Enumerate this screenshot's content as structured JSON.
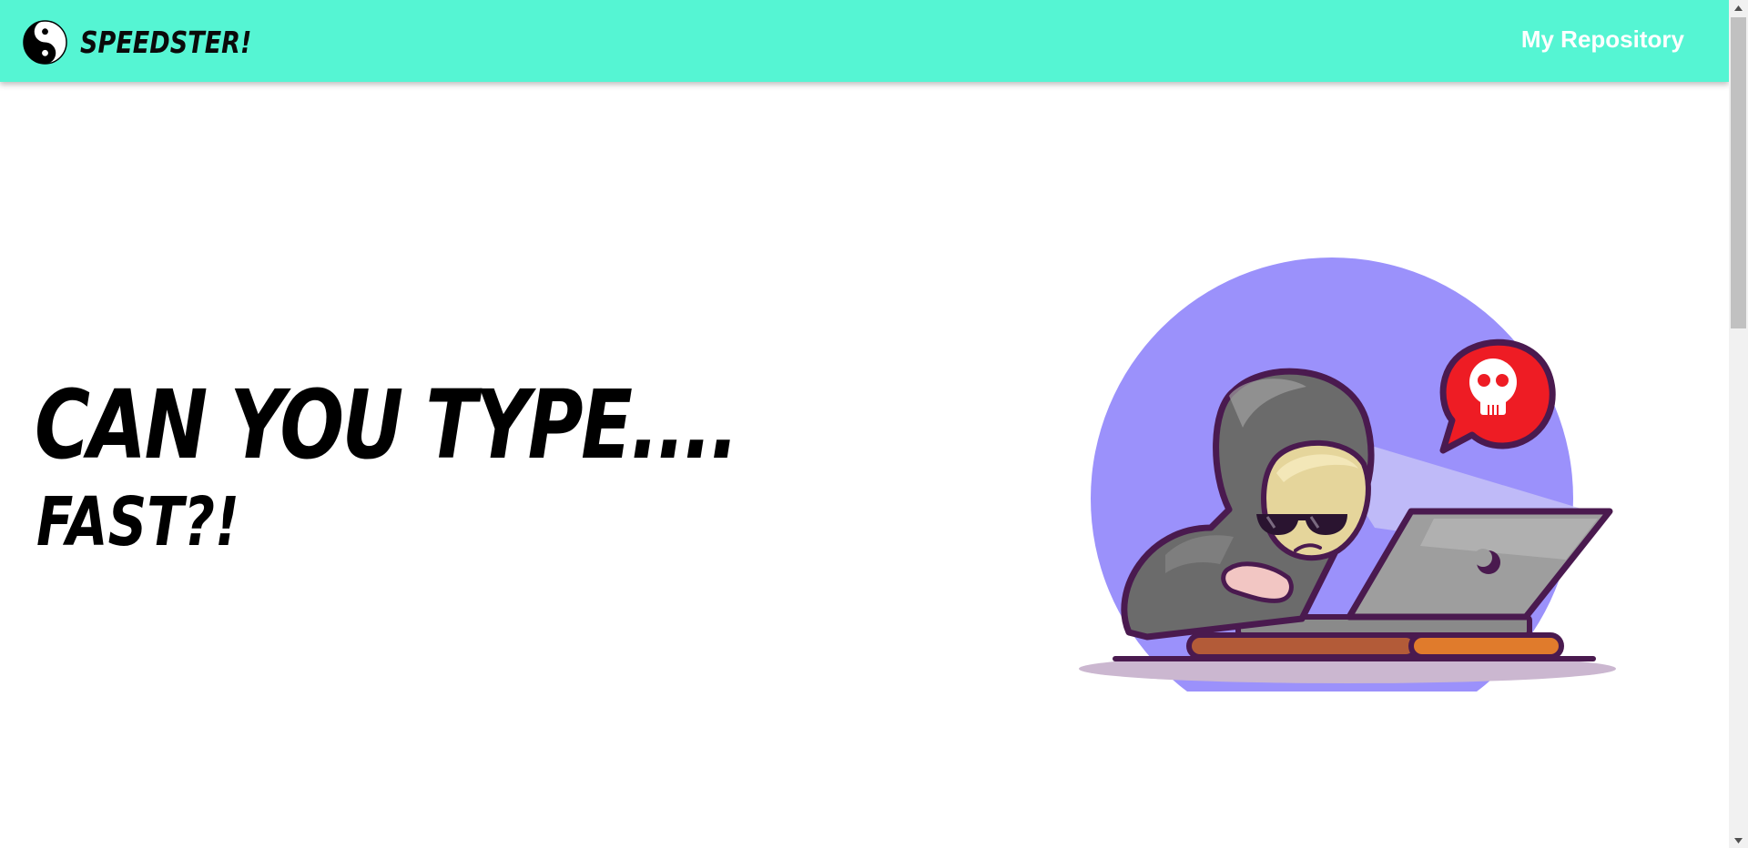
{
  "navbar": {
    "brand_name": "SPEEDSTER!",
    "brand_icon": "yin-yang-icon",
    "link_label": "My Repository",
    "background_color": "#55f5d3"
  },
  "hero": {
    "title": "CAN YOU TYPE....",
    "subtitle": "FAST?!",
    "illustration": "hooded-hacker-typing-on-laptop-illustration"
  },
  "scrollbar": {
    "up_icon": "scroll-up-arrow-icon",
    "down_icon": "scroll-down-arrow-icon"
  }
}
